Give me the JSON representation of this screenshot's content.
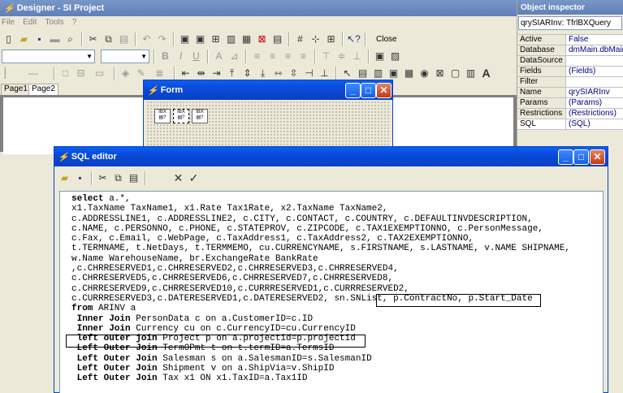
{
  "designer": {
    "title": "Designer - SI Project",
    "menu": [
      "File",
      "Edit",
      "Tools",
      "?"
    ],
    "close_label": "Close",
    "tabs": [
      "Page1",
      "Page2"
    ]
  },
  "inspector": {
    "title": "Object inspector",
    "object": "qrySIARInv: TfrlBXQuery",
    "props": [
      {
        "k": "Active",
        "v": "False"
      },
      {
        "k": "Database",
        "v": "dmMain.dbMain"
      },
      {
        "k": "DataSource",
        "v": ""
      },
      {
        "k": "Fields",
        "v": "(Fields)"
      },
      {
        "k": "Filter",
        "v": ""
      },
      {
        "k": "Name",
        "v": "qrySIARInv"
      },
      {
        "k": "Params",
        "v": "(Params)"
      },
      {
        "k": "Restrictions",
        "v": "(Restrictions)"
      },
      {
        "k": "SQL",
        "v": "(SQL)"
      }
    ]
  },
  "form": {
    "title": "Form",
    "components": [
      "IBX",
      "IBX",
      "IBX"
    ]
  },
  "sql_editor": {
    "title": "SQL editor",
    "lines": [
      {
        "kw": "select",
        "rest": " a.*,"
      },
      {
        "kw": "",
        "rest": "x1.TaxName TaxName1, x1.Rate Tax1Rate, x2.TaxName TaxName2,"
      },
      {
        "kw": "",
        "rest": "c.ADDRESSLINE1, c.ADDRESSLINE2, c.CITY, c.CONTACT, c.COUNTRY, c.DEFAULTINVDESCRIPTION,"
      },
      {
        "kw": "",
        "rest": "c.NAME, c.PERSONNO, c.PHONE, c.STATEPROV, c.ZIPCODE, c.TAX1EXEMPTIONNO, c.PersonMessage,"
      },
      {
        "kw": "",
        "rest": "c.Fax, c.Email, c.WebPage, c.TaxAddress1, c.TaxAddress2, c.TAX2EXEMPTIONNO,"
      },
      {
        "kw": "",
        "rest": "t.TERMNAME, t.NetDays, t.TERMMEMO, cu.CURRENCYNAME, s.FIRSTNAME, s.LASTNAME, v.NAME SHIPNAME,"
      },
      {
        "kw": "",
        "rest": "w.Name WarehouseName, br.ExchangeRate BankRate"
      },
      {
        "kw": "",
        "rest": ",c.CHRRESERVED1,c.CHRRESERVED2,c.CHRRESERVED3,c.CHRRESERVED4,"
      },
      {
        "kw": "",
        "rest": "c.CHRRESERVED5,c.CHRRESERVED6,c.CHRRESERVED7,c.CHRRESERVED8,"
      },
      {
        "kw": "",
        "rest": "c.CHRRESERVED9,c.CHRRESERVED10,c.CURRRESERVED1,c.CURRRESERVED2,"
      },
      {
        "kw": "",
        "rest": "c.CURRRESERVED3,c.DATERESERVED1,c.DATERESERVED2, sn.SNList, p.ContractNo, p.Start_Date"
      },
      {
        "kw": "from",
        "rest": " ARINV a"
      },
      {
        "kw": " Inner Join",
        "rest": " PersonData c on a.CustomerID=c.ID"
      },
      {
        "kw": " Inner Join",
        "rest": " Currency cu on c.CurrencyID=cu.CurrencyID"
      },
      {
        "kw": " left outer join",
        "rest": " Project p on a.projectid=p.projectid"
      },
      {
        "kw": " Left Outer Join",
        "rest": " TermOPmt t on t.termID=a.TermsID"
      },
      {
        "kw": " Left Outer Join",
        "rest": " Salesman s on a.SalesmanID=s.SalesmanID"
      },
      {
        "kw": " Left Outer Join",
        "rest": " Shipment v on a.ShipVia=v.ShipID"
      },
      {
        "kw": " Left Outer Join",
        "rest": " Tax x1 ON x1.TaxID=a.Tax1ID"
      }
    ]
  }
}
